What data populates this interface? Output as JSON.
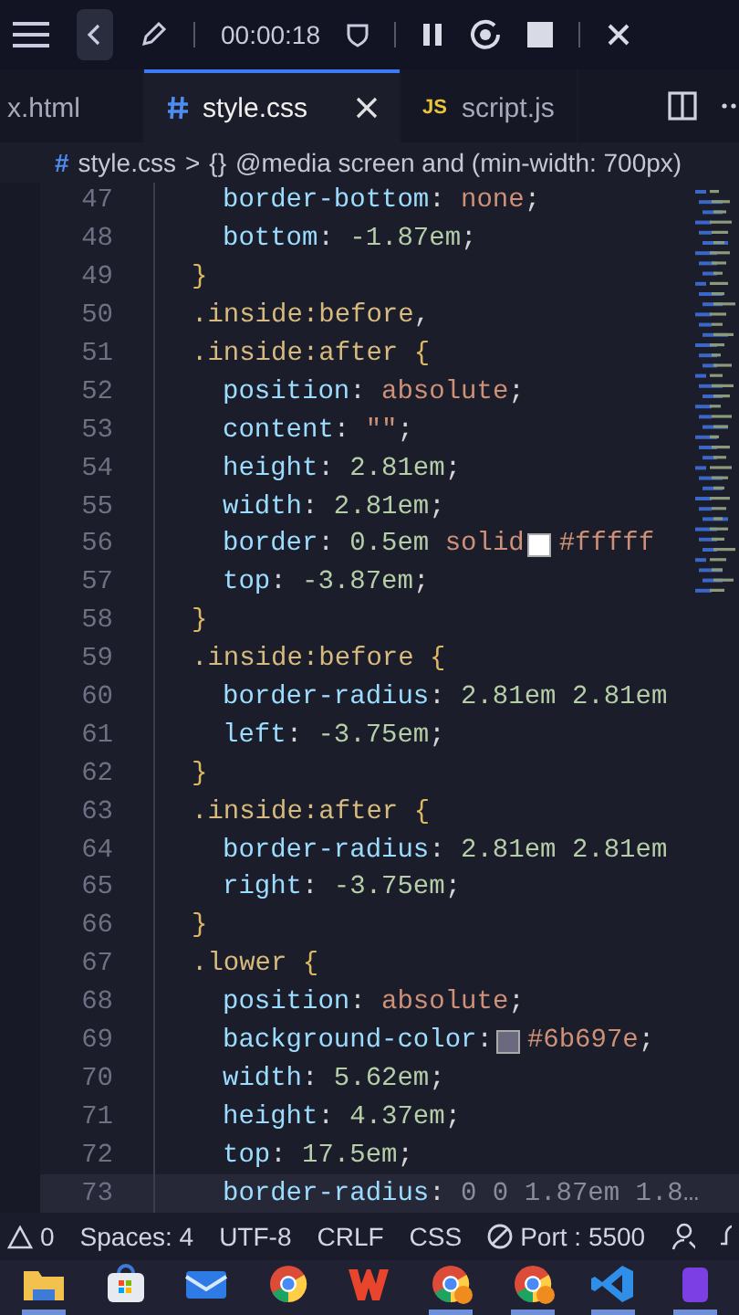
{
  "recorder": {
    "timer": "00:00:18"
  },
  "tabs": [
    {
      "label": "x.html",
      "kind": "plain",
      "selected": false,
      "closable": false
    },
    {
      "label": "style.css",
      "kind": "css",
      "selected": true,
      "closable": true
    },
    {
      "label": "script.js",
      "kind": "js",
      "icon_text": "JS",
      "selected": false,
      "closable": false
    }
  ],
  "breadcrumb": {
    "file_icon": "#",
    "file": "style.css",
    "separator": ">",
    "symbol_icon": "{}",
    "symbol": "@media screen and (min-width: 700px)"
  },
  "lines": [
    {
      "number": "47",
      "kind": "declaration",
      "selected": false,
      "tokens": [
        {
          "kind": "property",
          "text": "border-bottom"
        },
        {
          "kind": "punct",
          "text": ": "
        },
        {
          "kind": "value",
          "text": "none"
        },
        {
          "kind": "punct",
          "text": ";"
        }
      ]
    },
    {
      "number": "48",
      "kind": "declaration",
      "selected": false,
      "tokens": [
        {
          "kind": "property",
          "text": "bottom"
        },
        {
          "kind": "punct",
          "text": ": "
        },
        {
          "kind": "number",
          "text": "-1.87em"
        },
        {
          "kind": "punct",
          "text": ";"
        }
      ]
    },
    {
      "number": "49",
      "kind": "close",
      "selected": false,
      "tokens": [
        {
          "kind": "brace",
          "text": "}"
        }
      ]
    },
    {
      "number": "50",
      "kind": "selector",
      "selected": false,
      "tokens": [
        {
          "kind": "selector",
          "text": ".inside:before"
        },
        {
          "kind": "punct",
          "text": ","
        }
      ]
    },
    {
      "number": "51",
      "kind": "selector",
      "selected": false,
      "tokens": [
        {
          "kind": "selector",
          "text": ".inside:after"
        },
        {
          "kind": "brace",
          "text": " {"
        }
      ]
    },
    {
      "number": "52",
      "kind": "declaration",
      "selected": false,
      "tokens": [
        {
          "kind": "property",
          "text": "position"
        },
        {
          "kind": "punct",
          "text": ": "
        },
        {
          "kind": "value",
          "text": "absolute"
        },
        {
          "kind": "punct",
          "text": ";"
        }
      ]
    },
    {
      "number": "53",
      "kind": "declaration",
      "selected": false,
      "tokens": [
        {
          "kind": "property",
          "text": "content"
        },
        {
          "kind": "punct",
          "text": ": "
        },
        {
          "kind": "value",
          "text": "\"\""
        },
        {
          "kind": "punct",
          "text": ";"
        }
      ]
    },
    {
      "number": "54",
      "kind": "declaration",
      "selected": false,
      "tokens": [
        {
          "kind": "property",
          "text": "height"
        },
        {
          "kind": "punct",
          "text": ": "
        },
        {
          "kind": "number",
          "text": "2.81em"
        },
        {
          "kind": "punct",
          "text": ";"
        }
      ]
    },
    {
      "number": "55",
      "kind": "declaration",
      "selected": false,
      "tokens": [
        {
          "kind": "property",
          "text": "width"
        },
        {
          "kind": "punct",
          "text": ": "
        },
        {
          "kind": "number",
          "text": "2.81em"
        },
        {
          "kind": "punct",
          "text": ";"
        }
      ]
    },
    {
      "number": "56",
      "kind": "declaration",
      "selected": false,
      "tokens": [
        {
          "kind": "property",
          "text": "border"
        },
        {
          "kind": "punct",
          "text": ": "
        },
        {
          "kind": "number",
          "text": "0.5em"
        },
        {
          "kind": "value",
          "text": " solid "
        },
        {
          "kind": "swatch",
          "color": "#ffffff"
        },
        {
          "kind": "value",
          "text": "#fffff"
        }
      ]
    },
    {
      "number": "57",
      "kind": "declaration",
      "selected": false,
      "tokens": [
        {
          "kind": "property",
          "text": "top"
        },
        {
          "kind": "punct",
          "text": ": "
        },
        {
          "kind": "number",
          "text": "-3.87em"
        },
        {
          "kind": "punct",
          "text": ";"
        }
      ]
    },
    {
      "number": "58",
      "kind": "close",
      "selected": false,
      "tokens": [
        {
          "kind": "brace",
          "text": "}"
        }
      ]
    },
    {
      "number": "59",
      "kind": "selector",
      "selected": false,
      "tokens": [
        {
          "kind": "selector",
          "text": ".inside:before"
        },
        {
          "kind": "brace",
          "text": " {"
        }
      ]
    },
    {
      "number": "60",
      "kind": "declaration",
      "selected": false,
      "tokens": [
        {
          "kind": "property",
          "text": "border-radius"
        },
        {
          "kind": "punct",
          "text": ": "
        },
        {
          "kind": "number",
          "text": "2.81em 2.81em"
        }
      ]
    },
    {
      "number": "61",
      "kind": "declaration",
      "selected": false,
      "tokens": [
        {
          "kind": "property",
          "text": "left"
        },
        {
          "kind": "punct",
          "text": ": "
        },
        {
          "kind": "number",
          "text": "-3.75em"
        },
        {
          "kind": "punct",
          "text": ";"
        }
      ]
    },
    {
      "number": "62",
      "kind": "close",
      "selected": false,
      "tokens": [
        {
          "kind": "brace",
          "text": "}"
        }
      ]
    },
    {
      "number": "63",
      "kind": "selector",
      "selected": false,
      "tokens": [
        {
          "kind": "selector",
          "text": ".inside:after"
        },
        {
          "kind": "brace",
          "text": " {"
        }
      ]
    },
    {
      "number": "64",
      "kind": "declaration",
      "selected": false,
      "tokens": [
        {
          "kind": "property",
          "text": "border-radius"
        },
        {
          "kind": "punct",
          "text": ": "
        },
        {
          "kind": "number",
          "text": "2.81em 2.81em"
        }
      ]
    },
    {
      "number": "65",
      "kind": "declaration",
      "selected": false,
      "tokens": [
        {
          "kind": "property",
          "text": "right"
        },
        {
          "kind": "punct",
          "text": ": "
        },
        {
          "kind": "number",
          "text": "-3.75em"
        },
        {
          "kind": "punct",
          "text": ";"
        }
      ]
    },
    {
      "number": "66",
      "kind": "close",
      "selected": false,
      "tokens": [
        {
          "kind": "brace",
          "text": "}"
        }
      ]
    },
    {
      "number": "67",
      "kind": "selector",
      "selected": false,
      "tokens": [
        {
          "kind": "selector",
          "text": ".lower"
        },
        {
          "kind": "brace",
          "text": " {"
        }
      ]
    },
    {
      "number": "68",
      "kind": "declaration",
      "selected": false,
      "tokens": [
        {
          "kind": "property",
          "text": "position"
        },
        {
          "kind": "punct",
          "text": ": "
        },
        {
          "kind": "value",
          "text": "absolute"
        },
        {
          "kind": "punct",
          "text": ";"
        }
      ]
    },
    {
      "number": "69",
      "kind": "declaration",
      "selected": false,
      "tokens": [
        {
          "kind": "property",
          "text": "background-color"
        },
        {
          "kind": "punct",
          "text": ": "
        },
        {
          "kind": "swatch",
          "color": "#6b697e"
        },
        {
          "kind": "value",
          "text": "#6b697e"
        },
        {
          "kind": "punct",
          "text": ";"
        }
      ]
    },
    {
      "number": "70",
      "kind": "declaration",
      "selected": false,
      "tokens": [
        {
          "kind": "property",
          "text": "width"
        },
        {
          "kind": "punct",
          "text": ": "
        },
        {
          "kind": "number",
          "text": "5.62em"
        },
        {
          "kind": "punct",
          "text": ";"
        }
      ]
    },
    {
      "number": "71",
      "kind": "declaration",
      "selected": false,
      "tokens": [
        {
          "kind": "property",
          "text": "height"
        },
        {
          "kind": "punct",
          "text": ": "
        },
        {
          "kind": "number",
          "text": "4.37em"
        },
        {
          "kind": "punct",
          "text": ";"
        }
      ]
    },
    {
      "number": "72",
      "kind": "declaration",
      "selected": false,
      "tokens": [
        {
          "kind": "property",
          "text": "top"
        },
        {
          "kind": "punct",
          "text": ": "
        },
        {
          "kind": "number",
          "text": "17.5em"
        },
        {
          "kind": "punct",
          "text": ";"
        }
      ]
    },
    {
      "number": "73",
      "kind": "declaration",
      "selected": true,
      "tokens": [
        {
          "kind": "property",
          "text": "border-radius"
        },
        {
          "kind": "punct",
          "text": ": "
        },
        {
          "kind": "ghost",
          "text": "0 0 1.87em 1.8…"
        }
      ]
    }
  ],
  "status_bar": {
    "problems": "0",
    "items": [
      {
        "kind": "text",
        "text": "Spaces: 4"
      },
      {
        "kind": "text",
        "text": "UTF-8"
      },
      {
        "kind": "text",
        "text": "CRLF"
      },
      {
        "kind": "text",
        "text": "CSS"
      },
      {
        "kind": "port",
        "text": "Port : 5500"
      }
    ]
  },
  "taskbar": [
    {
      "kind": "folder",
      "open": true
    },
    {
      "kind": "store",
      "open": false
    },
    {
      "kind": "mail",
      "open": false
    },
    {
      "kind": "chrome",
      "open": false
    },
    {
      "kind": "office",
      "open": false
    },
    {
      "kind": "chrome-badge",
      "open": true
    },
    {
      "kind": "chrome-n",
      "open": true
    },
    {
      "kind": "vscode",
      "open": true
    },
    {
      "kind": "purple",
      "open": true
    }
  ]
}
